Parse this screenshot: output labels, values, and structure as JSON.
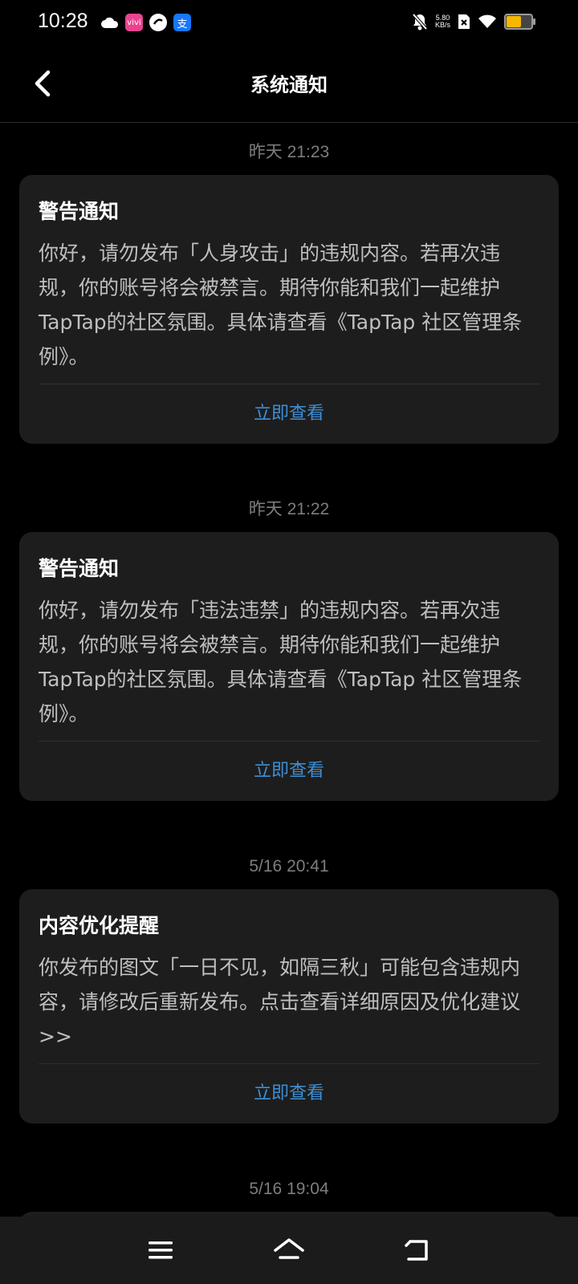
{
  "status_bar": {
    "time": "10:28",
    "speed_value": "5.80",
    "speed_unit": "KB/s",
    "battery_level": 0.55,
    "battery_color": "#f5b800"
  },
  "header": {
    "title": "系统通知",
    "back_icon": "chevron-left-icon"
  },
  "notifications": [
    {
      "timestamp": "昨天  21:23",
      "title": "警告通知",
      "body": "你好，请勿发布「人身攻击」的违规内容。若再次违规，你的账号将会被禁言。期待你能和我们一起维护TapTap的社区氛围。具体请查看《TapTap 社区管理条例》。",
      "action": "立即查看"
    },
    {
      "timestamp": "昨天  21:22",
      "title": "警告通知",
      "body": "你好，请勿发布「违法违禁」的违规内容。若再次违规，你的账号将会被禁言。期待你能和我们一起维护TapTap的社区氛围。具体请查看《TapTap 社区管理条例》。",
      "action": "立即查看"
    },
    {
      "timestamp": "5/16  20:41",
      "title": "内容优化提醒",
      "body": "你发布的图文「一日不见，如隔三秋」可能包含违规内容，请修改后重新发布。点击查看详细原因及优化建议>>",
      "action": "立即查看"
    },
    {
      "timestamp": "5/16  19:04"
    }
  ],
  "accent_color": "#3d8fd6",
  "nav_bar": {
    "menu_icon": "menu-icon",
    "home_icon": "home-icon",
    "back_icon": "back-arrow-icon"
  }
}
